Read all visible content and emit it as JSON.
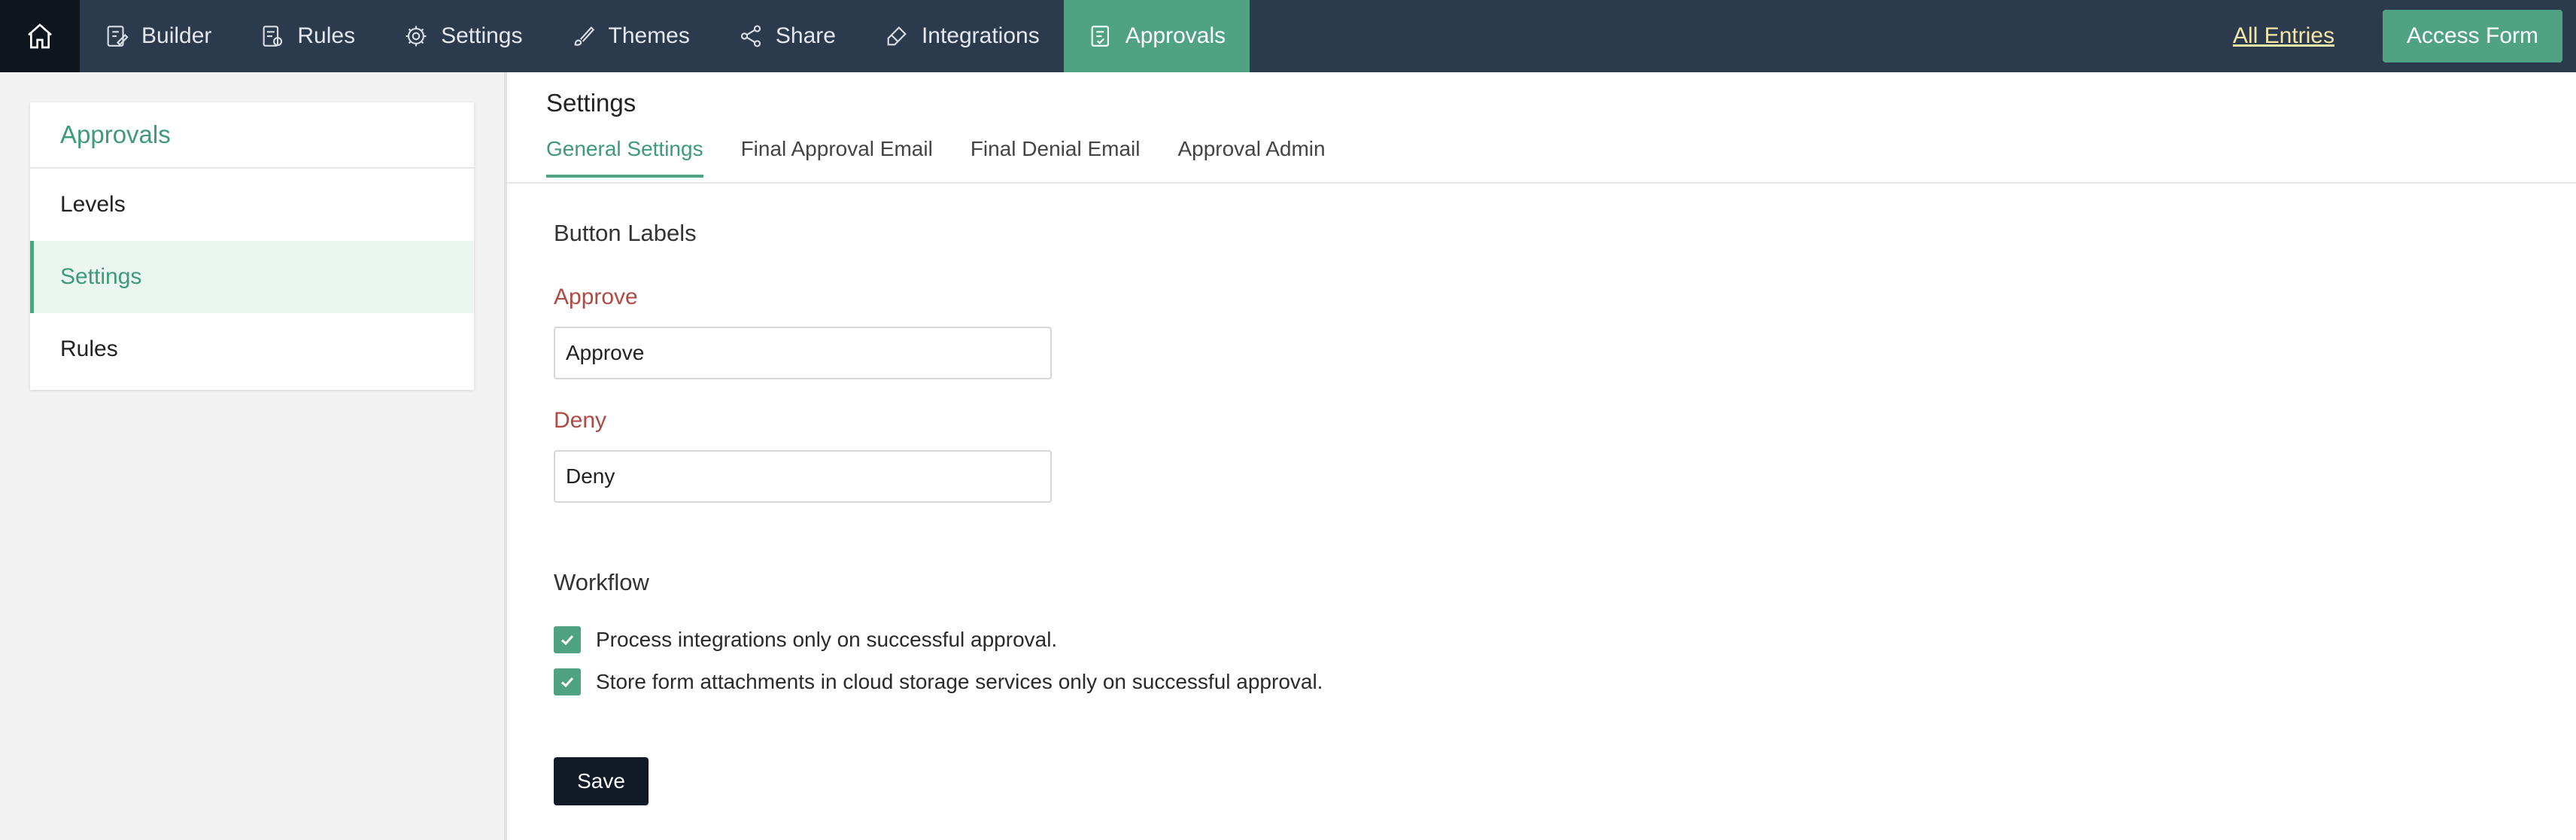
{
  "topnav": {
    "items": [
      {
        "label": "Builder",
        "icon": "builder-icon"
      },
      {
        "label": "Rules",
        "icon": "rules-icon"
      },
      {
        "label": "Settings",
        "icon": "gear-icon"
      },
      {
        "label": "Themes",
        "icon": "brush-icon"
      },
      {
        "label": "Share",
        "icon": "share-icon"
      },
      {
        "label": "Integrations",
        "icon": "plug-icon"
      },
      {
        "label": "Approvals",
        "icon": "approvals-icon"
      }
    ],
    "all_entries": "All Entries",
    "access_form": "Access Form"
  },
  "sidebar": {
    "title": "Approvals",
    "items": [
      {
        "label": "Levels"
      },
      {
        "label": "Settings"
      },
      {
        "label": "Rules"
      }
    ]
  },
  "main": {
    "title": "Settings",
    "tabs": [
      {
        "label": "General Settings"
      },
      {
        "label": "Final Approval Email"
      },
      {
        "label": "Final Denial Email"
      },
      {
        "label": "Approval Admin"
      }
    ],
    "button_labels": {
      "heading": "Button Labels",
      "approve_label": "Approve",
      "approve_value": "Approve",
      "deny_label": "Deny",
      "deny_value": "Deny"
    },
    "workflow": {
      "heading": "Workflow",
      "options": [
        {
          "label": "Process integrations only on successful approval.",
          "checked": true
        },
        {
          "label": "Store form attachments in cloud storage services only on successful approval.",
          "checked": true
        }
      ]
    },
    "save_label": "Save"
  },
  "colors": {
    "nav_bg": "#2c3a4d",
    "accent": "#4fa383",
    "label_red": "#b04a45",
    "save_bg": "#111a26"
  }
}
